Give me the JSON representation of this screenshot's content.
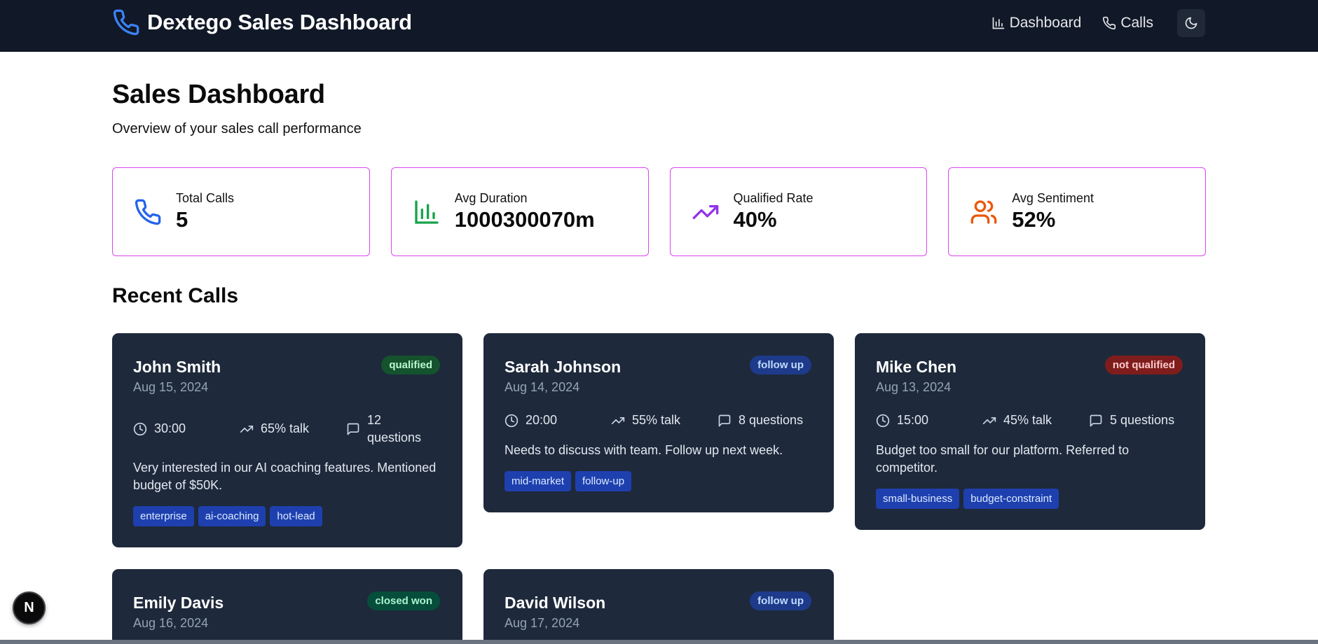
{
  "app": {
    "title": "Dextego Sales Dashboard"
  },
  "nav": {
    "links": [
      {
        "label": "Dashboard",
        "icon": "bar-chart-icon"
      },
      {
        "label": "Calls",
        "icon": "phone-icon"
      }
    ],
    "theme_toggle_icon": "moon-icon"
  },
  "header": {
    "title": "Sales Dashboard",
    "subtitle": "Overview of your sales call performance"
  },
  "stats": [
    {
      "label": "Total Calls",
      "value": "5",
      "icon": "phone-icon",
      "color": "#2563eb"
    },
    {
      "label": "Avg Duration",
      "value": "1000300070m",
      "icon": "bar-chart-icon",
      "color": "#16a34a"
    },
    {
      "label": "Qualified Rate",
      "value": "40%",
      "icon": "trending-up-icon",
      "color": "#9333ea"
    },
    {
      "label": "Avg Sentiment",
      "value": "52%",
      "icon": "users-icon",
      "color": "#ea580c"
    }
  ],
  "recent": {
    "title": "Recent Calls",
    "calls": [
      {
        "name": "John Smith",
        "date": "Aug 15, 2024",
        "status": "qualified",
        "duration": "30:00",
        "talk": "65% talk",
        "questions": "12 questions",
        "notes": "Very interested in our AI coaching features. Mentioned budget of $50K.",
        "tags": [
          "enterprise",
          "ai-coaching",
          "hot-lead"
        ]
      },
      {
        "name": "Sarah Johnson",
        "date": "Aug 14, 2024",
        "status": "follow up",
        "duration": "20:00",
        "talk": "55% talk",
        "questions": "8 questions",
        "notes": "Needs to discuss with team. Follow up next week.",
        "tags": [
          "mid-market",
          "follow-up"
        ]
      },
      {
        "name": "Mike Chen",
        "date": "Aug 13, 2024",
        "status": "not qualified",
        "duration": "15:00",
        "talk": "45% talk",
        "questions": "5 questions",
        "notes": "Budget too small for our platform. Referred to competitor.",
        "tags": [
          "small-business",
          "budget-constraint"
        ]
      },
      {
        "name": "Emily Davis",
        "date": "Aug 16, 2024",
        "status": "closed won"
      },
      {
        "name": "David Wilson",
        "date": "Aug 17, 2024",
        "status": "follow up"
      }
    ]
  },
  "colors": {
    "navbar_bg": "#111827",
    "card_bg": "#1e293b",
    "stat_border": "#d946ef",
    "brand_icon": "#3b82f6"
  },
  "dev_badge": {
    "label": "N"
  }
}
